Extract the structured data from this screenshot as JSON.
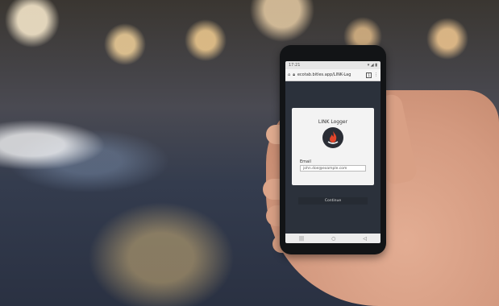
{
  "phone": {
    "status_time": "17:21",
    "status_right": "▾ ◢ ▮",
    "url": "ecotab.bitles.app/LINK-Lag",
    "tab_count": "1",
    "card_title": "LINK Logger",
    "field_label": "Email",
    "field_value": "john.doe@example.com",
    "submit_label": "Continue",
    "nav": {
      "back": "◁",
      "home": "○",
      "recents": "|||"
    }
  },
  "colors": {
    "card_bg": "#f3f3f3",
    "page_bg": "#2b313b",
    "logo_bg": "#2a2d35",
    "logo_flame": "#e2452a"
  }
}
